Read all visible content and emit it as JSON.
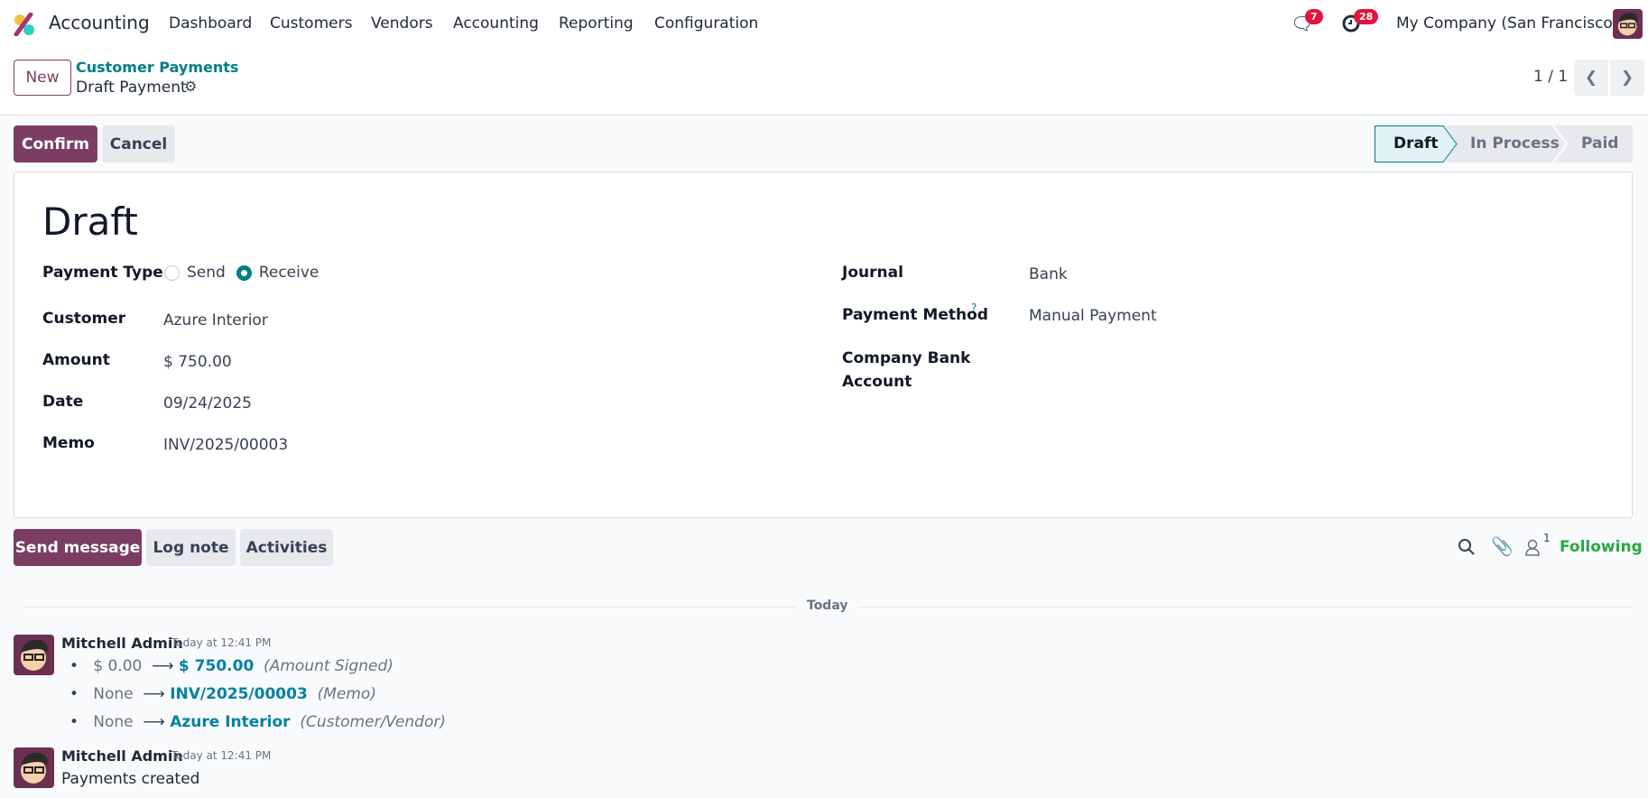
{
  "nav": {
    "app": "Accounting",
    "menu": [
      "Dashboard",
      "Customers",
      "Vendors",
      "Accounting",
      "Reporting",
      "Configuration"
    ],
    "messages_count": "7",
    "activities_count": "28",
    "company": "My Company (San Francisco)"
  },
  "control": {
    "new_label": "New",
    "breadcrumb_parent": "Customer Payments",
    "breadcrumb_current": "Draft Payment",
    "pager": "1 / 1"
  },
  "actions": {
    "confirm": "Confirm",
    "cancel": "Cancel"
  },
  "statusbar": {
    "stages": [
      "Draft",
      "In Process",
      "Paid"
    ],
    "active": "Draft"
  },
  "form": {
    "title": "Draft",
    "payment_type_label": "Payment Type",
    "payment_type_options": [
      "Send",
      "Receive"
    ],
    "payment_type_selected": "Receive",
    "customer_label": "Customer",
    "customer": "Azure Interior",
    "amount_label": "Amount",
    "amount": "$ 750.00",
    "date_label": "Date",
    "date": "09/24/2025",
    "memo_label": "Memo",
    "memo": "INV/2025/00003",
    "journal_label": "Journal",
    "journal": "Bank",
    "payment_method_label": "Payment Method",
    "payment_method_help": "?",
    "payment_method": "Manual Payment",
    "bank_account_label": "Company Bank Account"
  },
  "chatter": {
    "send_message": "Send message",
    "log_note": "Log note",
    "activities": "Activities",
    "followers_count": "1",
    "following": "Following",
    "divider": "Today",
    "messages": [
      {
        "author": "Mitchell Admin",
        "time": "Today at 12:41 PM",
        "changes": [
          {
            "old": "$ 0.00",
            "new": "$ 750.00",
            "field": "(Amount Signed)"
          },
          {
            "old": "None",
            "new": "INV/2025/00003",
            "field": "(Memo)"
          },
          {
            "old": "None",
            "new": "Azure Interior",
            "field": "(Customer/Vendor)"
          }
        ]
      },
      {
        "author": "Mitchell Admin",
        "time": "Today at 12:41 PM",
        "body": "Payments created"
      }
    ]
  },
  "colors": {
    "brand": "#7c3d63",
    "teal": "#017e84",
    "following": "#28a745",
    "badge": "#e4123d"
  }
}
